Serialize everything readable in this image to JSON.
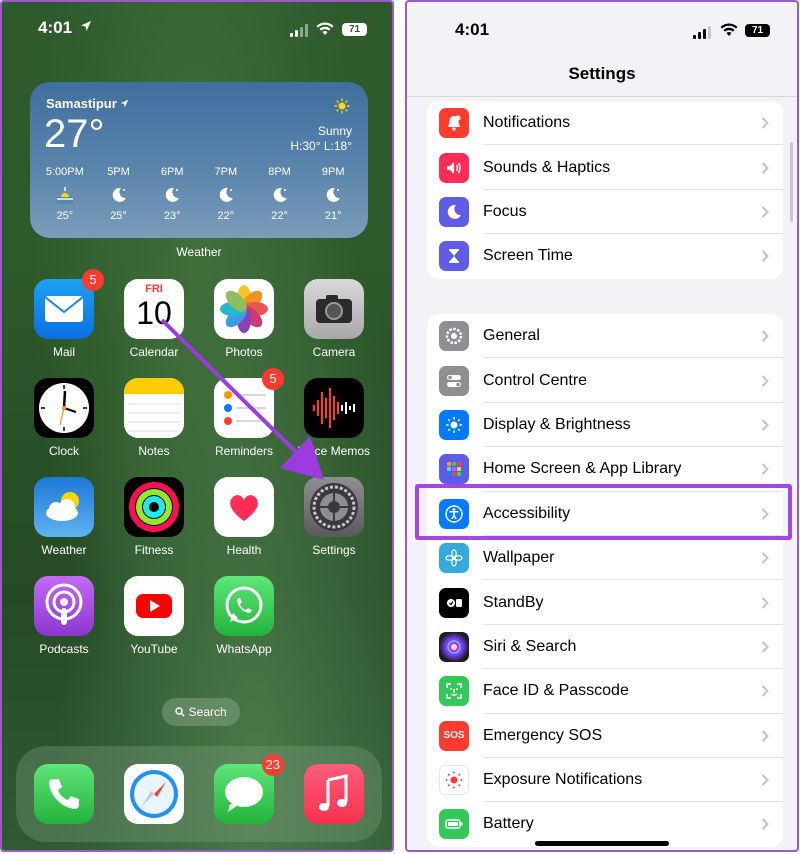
{
  "home": {
    "status": {
      "time": "4:01",
      "battery": "71"
    },
    "weather": {
      "city": "Samastipur",
      "temp": "27°",
      "condition": "Sunny",
      "high_low": "H:30° L:18°",
      "label": "Weather",
      "hours": [
        {
          "time": "5:00PM",
          "icon": "sunset-icon",
          "temp": "25°"
        },
        {
          "time": "5PM",
          "icon": "moon-icon",
          "temp": "25°"
        },
        {
          "time": "6PM",
          "icon": "moon-icon",
          "temp": "23°"
        },
        {
          "time": "7PM",
          "icon": "moon-icon",
          "temp": "22°"
        },
        {
          "time": "8PM",
          "icon": "moon-icon",
          "temp": "22°"
        },
        {
          "time": "9PM",
          "icon": "moon-icon",
          "temp": "21°"
        }
      ]
    },
    "apps": [
      {
        "label": "Mail",
        "icon": "mail-icon",
        "badge": "5"
      },
      {
        "label": "Calendar",
        "icon": "calendar-icon",
        "day": "FRI",
        "date": "10"
      },
      {
        "label": "Photos",
        "icon": "photos-icon"
      },
      {
        "label": "Camera",
        "icon": "camera-icon"
      },
      {
        "label": "Clock",
        "icon": "clock-icon"
      },
      {
        "label": "Notes",
        "icon": "notes-icon"
      },
      {
        "label": "Reminders",
        "icon": "reminders-icon",
        "badge": "5"
      },
      {
        "label": "Voice Memos",
        "icon": "voice-memos-icon"
      },
      {
        "label": "Weather",
        "icon": "weather-app-icon"
      },
      {
        "label": "Fitness",
        "icon": "fitness-icon"
      },
      {
        "label": "Health",
        "icon": "health-icon"
      },
      {
        "label": "Settings",
        "icon": "settings-gear-icon"
      },
      {
        "label": "Podcasts",
        "icon": "podcasts-icon"
      },
      {
        "label": "YouTube",
        "icon": "youtube-icon"
      },
      {
        "label": "WhatsApp",
        "icon": "whatsapp-icon"
      }
    ],
    "search_label": "Search",
    "dock": [
      {
        "name": "phone",
        "icon": "phone-icon"
      },
      {
        "name": "safari",
        "icon": "safari-icon"
      },
      {
        "name": "messages",
        "icon": "messages-icon",
        "badge": "23"
      },
      {
        "name": "music",
        "icon": "music-icon"
      }
    ]
  },
  "settings": {
    "status": {
      "time": "4:01",
      "battery": "71"
    },
    "title": "Settings",
    "group1": [
      {
        "label": "Notifications",
        "icon": "bell-icon",
        "color": "#ff3b30"
      },
      {
        "label": "Sounds & Haptics",
        "icon": "speaker-icon",
        "color": "#ff2d55"
      },
      {
        "label": "Focus",
        "icon": "moon-icon",
        "color": "#5e5ce6"
      },
      {
        "label": "Screen Time",
        "icon": "hourglass-icon",
        "color": "#5e5ce6"
      }
    ],
    "group2": [
      {
        "label": "General",
        "icon": "gear-icon",
        "color": "#8e8e93"
      },
      {
        "label": "Control Centre",
        "icon": "toggles-icon",
        "color": "#8e8e93"
      },
      {
        "label": "Display & Brightness",
        "icon": "sun-icon",
        "color": "#007aff"
      },
      {
        "label": "Home Screen & App Library",
        "icon": "app-grid-icon",
        "color": "#5e5ce6"
      },
      {
        "label": "Accessibility",
        "icon": "accessibility-icon",
        "color": "#007aff"
      },
      {
        "label": "Wallpaper",
        "icon": "flower-icon",
        "color": "#34aadc"
      },
      {
        "label": "StandBy",
        "icon": "standby-icon",
        "color": "#000000"
      },
      {
        "label": "Siri & Search",
        "icon": "siri-icon",
        "color": "#1c1c1e"
      },
      {
        "label": "Face ID & Passcode",
        "icon": "face-id-icon",
        "color": "#34c759"
      },
      {
        "label": "Emergency SOS",
        "icon": "sos-icon",
        "color": "#ff3b30",
        "text": "SOS"
      },
      {
        "label": "Exposure Notifications",
        "icon": "exposure-icon",
        "color": "#ffffff"
      },
      {
        "label": "Battery",
        "icon": "battery-icon",
        "color": "#34c759"
      }
    ],
    "highlighted": "Accessibility"
  }
}
